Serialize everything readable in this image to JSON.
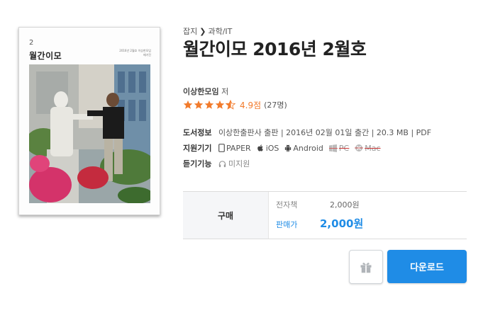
{
  "cover": {
    "issue_number": "2",
    "title": "월간이모",
    "subtitle": "2016년 2월호 이상한모임 매거진"
  },
  "breadcrumb": {
    "category": "잡지",
    "separator": "❯",
    "subcategory": "과학/IT"
  },
  "book": {
    "title": "월간이모 2016년 2월호",
    "author": "이상한모임",
    "author_suffix": " 저",
    "rating_score": "4.9점",
    "rating_count": "(27명)",
    "rating_value": 4.9,
    "stars_total": 5
  },
  "info": {
    "book_info_label": "도서정보",
    "book_info_value": "이상한출판사 출판 | 2016년 02월 01일 출간 | 20.3 MB | PDF",
    "devices_label": "지원기기",
    "devices": [
      {
        "name": "PAPER",
        "icon": "paper-device-icon",
        "supported": true
      },
      {
        "name": "iOS",
        "icon": "apple-icon",
        "supported": true
      },
      {
        "name": "Android",
        "icon": "android-icon",
        "supported": true
      },
      {
        "name": "PC",
        "icon": "pc-icon",
        "supported": false
      },
      {
        "name": "Mac",
        "icon": "mac-icon",
        "supported": false
      }
    ],
    "listen_label": "듣기기능",
    "listen_value": "미지원"
  },
  "price": {
    "section_label": "구매",
    "ebook_label": "전자책",
    "ebook_price": "2,000원",
    "sale_label": "판매가",
    "sale_price": "2,000원"
  },
  "actions": {
    "gift_icon": "gift-icon",
    "download_label": "다운로드"
  },
  "colors": {
    "accent_blue": "#1f8ce6",
    "star_orange": "#f27b2c",
    "unsupported_red": "#c33"
  }
}
